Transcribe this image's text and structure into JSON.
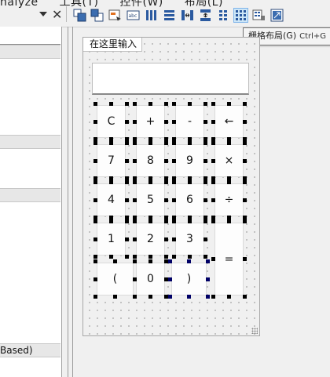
{
  "menubar": {
    "items": [
      "nalyze",
      "工具(T)",
      "控件(W)",
      "布局(L)"
    ]
  },
  "toolbar": {
    "buttons": [
      {
        "icon": "bring-front-icon"
      },
      {
        "icon": "send-back-icon"
      },
      {
        "icon": "tab-order-icon"
      },
      {
        "icon": "edit-buddies-icon"
      },
      {
        "icon": "layout-horizontal-icon"
      },
      {
        "icon": "layout-vertical-icon"
      },
      {
        "icon": "layout-hsplitter-icon"
      },
      {
        "icon": "layout-vsplitter-icon"
      },
      {
        "icon": "form-layout-icon"
      },
      {
        "icon": "grid-layout-icon",
        "active": true
      },
      {
        "icon": "break-layout-icon"
      },
      {
        "icon": "adjust-size-icon"
      }
    ]
  },
  "tooltip": {
    "text": "栅格布局(G)",
    "shortcut": "Ctrl+G"
  },
  "left_panel": {
    "row_text": "Based)"
  },
  "form": {
    "title": "在这里输入",
    "display_value": "",
    "buttons": [
      "C",
      "+",
      "-",
      "←",
      "7",
      "8",
      "9",
      "×",
      "4",
      "5",
      "6",
      "÷",
      "1",
      "2",
      "3",
      "=",
      "(",
      "0",
      ")"
    ]
  },
  "colors": {
    "tooltip_border": "#777777",
    "active_tool_bg": "#cde6f7",
    "selection_handle": "#000000",
    "selected_widget_handle": "#000066"
  }
}
